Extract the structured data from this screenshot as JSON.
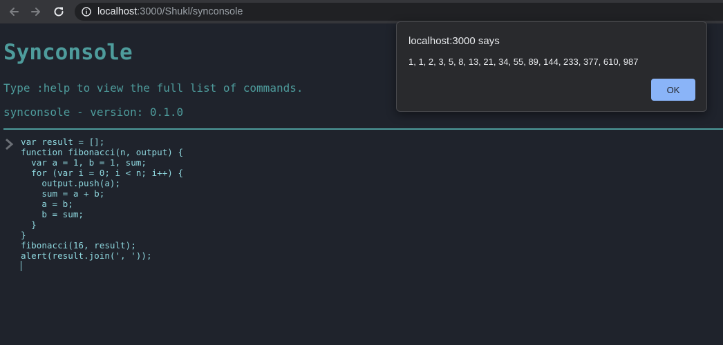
{
  "browser": {
    "url_host": "localhost",
    "url_rest": ":3000/Shukl/synconsole",
    "back_icon": "arrow-left-icon",
    "forward_icon": "arrow-right-icon",
    "reload_icon": "reload-icon",
    "site_info_icon": "info-circle-icon"
  },
  "page": {
    "title": "Synconsole",
    "hint": "Type :help to view the full list of commands.",
    "version": "synconsole - version: 0.1.0",
    "prompt_icon": "chevron-right-icon",
    "code": "var result = [];\nfunction fibonacci(n, output) {\n  var a = 1, b = 1, sum;\n  for (var i = 0; i < n; i++) {\n    output.push(a);\n    sum = a + b;\n    a = b;\n    b = sum;\n  }\n}\nfibonacci(16, result);\nalert(result.join(', '));"
  },
  "dialog": {
    "title": "localhost:3000 says",
    "message": "1, 1, 2, 3, 5, 8, 13, 21, 34, 55, 89, 144, 233, 377, 610, 987",
    "ok_label": "OK"
  },
  "colors": {
    "accent": "#4e9c9c",
    "code_text": "#8fd8df",
    "background": "#1f232c",
    "ok_button": "#8ab4f8"
  }
}
